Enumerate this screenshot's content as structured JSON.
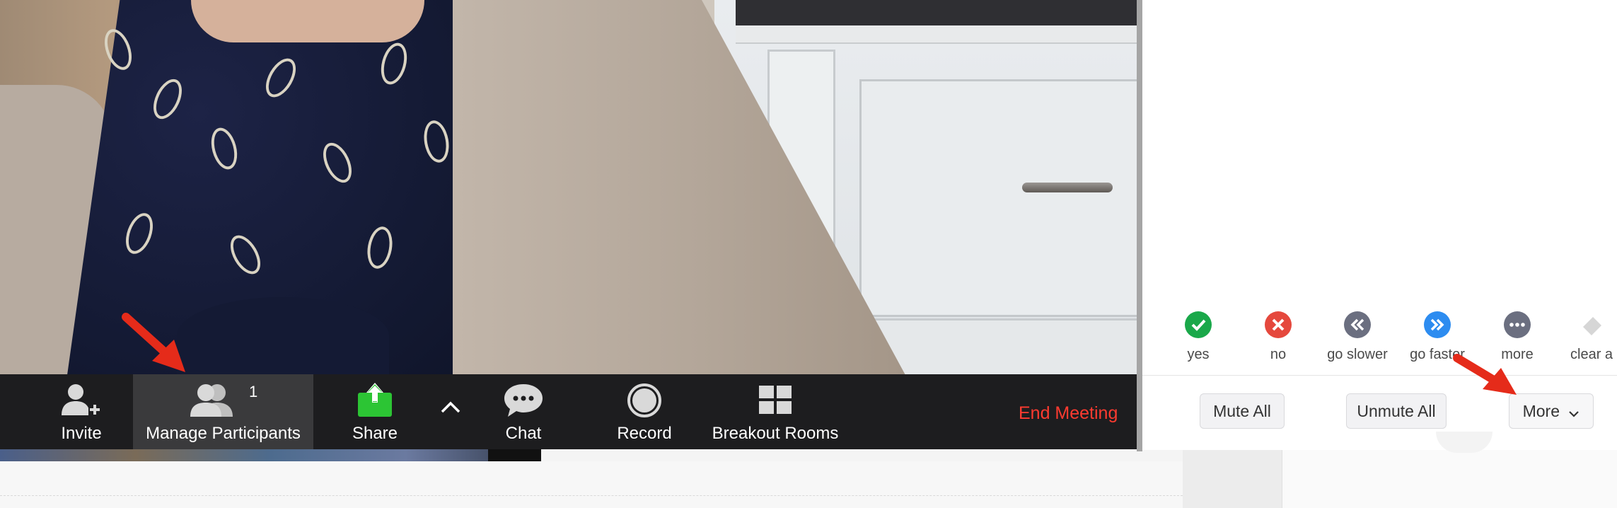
{
  "toolbar": {
    "invite_label": "Invite",
    "manage_participants_label": "Manage Participants",
    "participant_count": "1",
    "share_label": "Share",
    "chat_label": "Chat",
    "record_label": "Record",
    "breakout_rooms_label": "Breakout Rooms",
    "end_meeting_label": "End Meeting"
  },
  "feedback": {
    "items": [
      {
        "label": "yes",
        "icon": "check-icon",
        "color": "#1aa84a"
      },
      {
        "label": "no",
        "icon": "x-icon",
        "color": "#e5483d"
      },
      {
        "label": "go slower",
        "icon": "rewind-icon",
        "color": "#6b6f80"
      },
      {
        "label": "go faster",
        "icon": "fast-forward-icon",
        "color": "#2d8cf0"
      },
      {
        "label": "more",
        "icon": "ellipsis-icon",
        "color": "#6b6f80"
      },
      {
        "label": "clear a",
        "icon": "eraser-icon",
        "color": "#d0d0d0"
      }
    ]
  },
  "panel": {
    "mute_all_label": "Mute All",
    "unmute_all_label": "Unmute All",
    "more_label": "More"
  },
  "colors": {
    "end_meeting": "#ff3b30",
    "share_green": "#2cc534",
    "arrow_red": "#e52b1a"
  }
}
